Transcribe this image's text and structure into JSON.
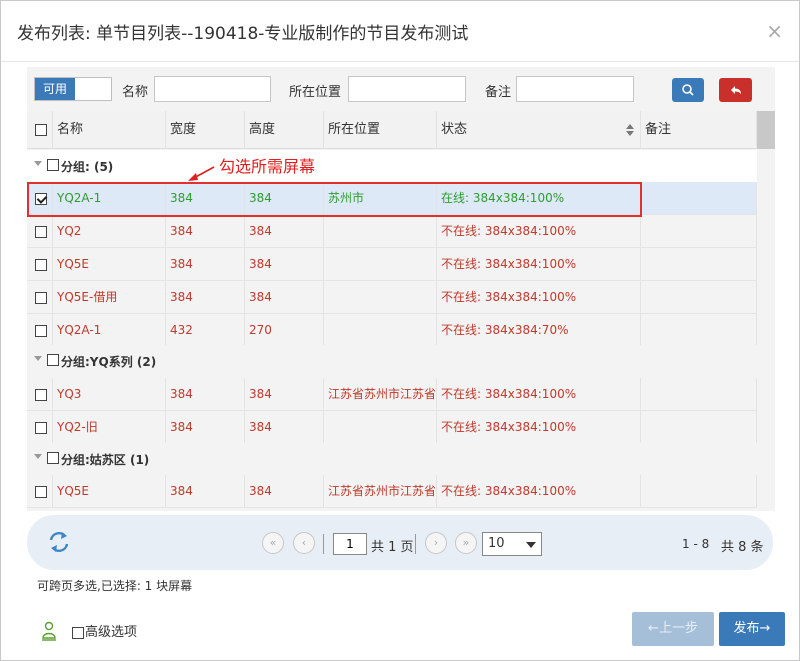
{
  "dialog": {
    "title": "发布列表: 单节目列表--190418-专业版制作的节目发布测试",
    "close_icon": "×"
  },
  "filters": {
    "toggle_label": "可用",
    "name_label": "名称",
    "name_value": "",
    "location_label": "所在位置",
    "location_value": "",
    "remark_label": "备注",
    "remark_value": ""
  },
  "columns": {
    "name": "名称",
    "width": "宽度",
    "height": "高度",
    "location": "所在位置",
    "status": "状态",
    "remark": "备注"
  },
  "annotation": "勾选所需屏幕",
  "groups": [
    {
      "label": "分组: (5)"
    },
    {
      "label": "分组:YQ系列 (2)"
    },
    {
      "label": "分组:姑苏区 (1)"
    }
  ],
  "rows": [
    {
      "name": "YQ2A-1",
      "width": "384",
      "height": "384",
      "location": "苏州市",
      "status": "在线: 384x384:100%",
      "checked": true
    },
    {
      "name": "YQ2",
      "width": "384",
      "height": "384",
      "location": "",
      "status": "不在线: 384x384:100%",
      "checked": false
    },
    {
      "name": "YQ5E",
      "width": "384",
      "height": "384",
      "location": "",
      "status": "不在线: 384x384:100%",
      "checked": false
    },
    {
      "name": "YQ5E-借用",
      "width": "384",
      "height": "384",
      "location": "",
      "status": "不在线: 384x384:100%",
      "checked": false
    },
    {
      "name": "YQ2A-1",
      "width": "432",
      "height": "270",
      "location": "",
      "status": "不在线: 384x384:70%",
      "checked": false
    },
    {
      "name": "YQ3",
      "width": "384",
      "height": "384",
      "location": "江苏省苏州市江苏省",
      "status": "不在线: 384x384:100%",
      "checked": false
    },
    {
      "name": "YQ2-旧",
      "width": "384",
      "height": "384",
      "location": "",
      "status": "不在线: 384x384:100%",
      "checked": false
    },
    {
      "name": "YQ5E",
      "width": "384",
      "height": "384",
      "location": "江苏省苏州市江苏省",
      "status": "不在线: 384x384:100%",
      "checked": false
    }
  ],
  "pager": {
    "current_page": "1",
    "total_pages": "共 1 页",
    "page_size": "10",
    "range": "1 - 8",
    "total": "共 8 条"
  },
  "selection": {
    "text": "可跨页多选,已选择: 1 块屏幕"
  },
  "footer": {
    "advanced_label": "高级选项",
    "prev_label": "←上一步",
    "publish_label": "发布→"
  },
  "colors": {
    "accent": "#3b7ab8",
    "online": "#2e9d2e",
    "offline": "#c0392b",
    "annotation": "#e02020"
  }
}
